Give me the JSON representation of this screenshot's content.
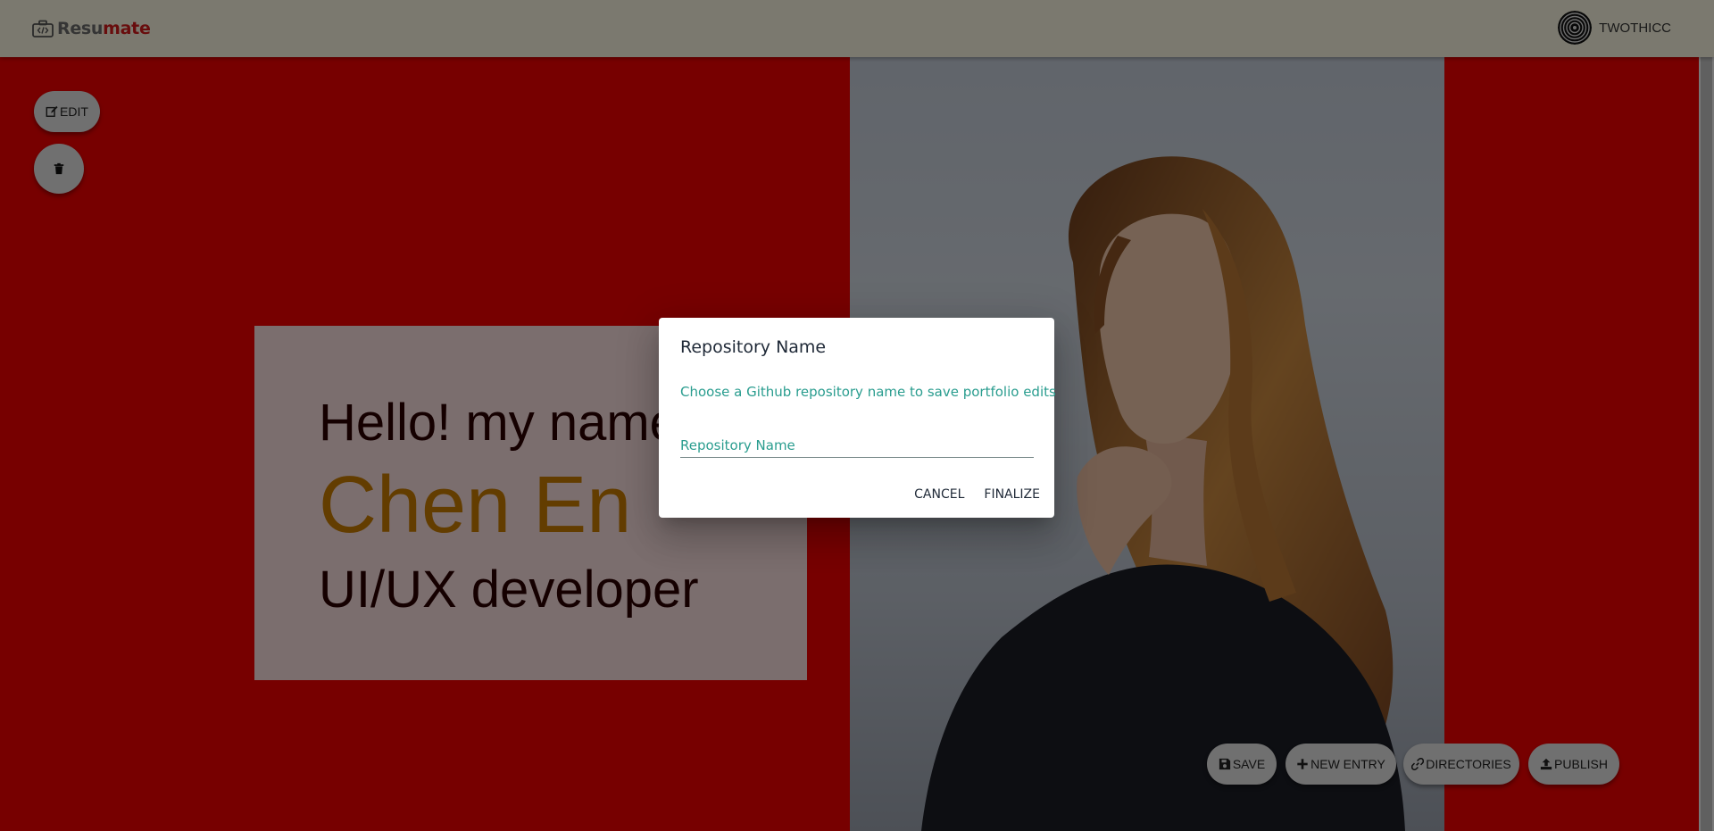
{
  "app": {
    "logo_part1": "Resu",
    "logo_part2": "mate",
    "username": "TWOTHICC"
  },
  "toolbar": {
    "edit_label": "EDIT"
  },
  "intro": {
    "greeting": "Hello! my name",
    "name": "Chen En",
    "role": "UI/UX developer"
  },
  "actions": {
    "save": "SAVE",
    "new_entry": "NEW ENTRY",
    "directories": "DIRECTORIES",
    "publish": "PUBLISH"
  },
  "dialog": {
    "title": "Repository Name",
    "text": "Choose a Github repository name to save portfolio edits",
    "input_placeholder": "Repository Name",
    "cancel": "CANCEL",
    "finalize": "FINALIZE"
  },
  "colors": {
    "hero_bg": "#ee0000",
    "name_color": "#c77a00",
    "accent_teal": "#2a9d8f"
  },
  "icons": {
    "logo": "code-briefcase-icon",
    "avatar": "spiral-avatar",
    "edit": "edit-icon",
    "delete": "trash-icon",
    "save": "floppy-icon",
    "new_entry": "plus-icon",
    "directories": "link-icon",
    "publish": "upload-icon"
  }
}
